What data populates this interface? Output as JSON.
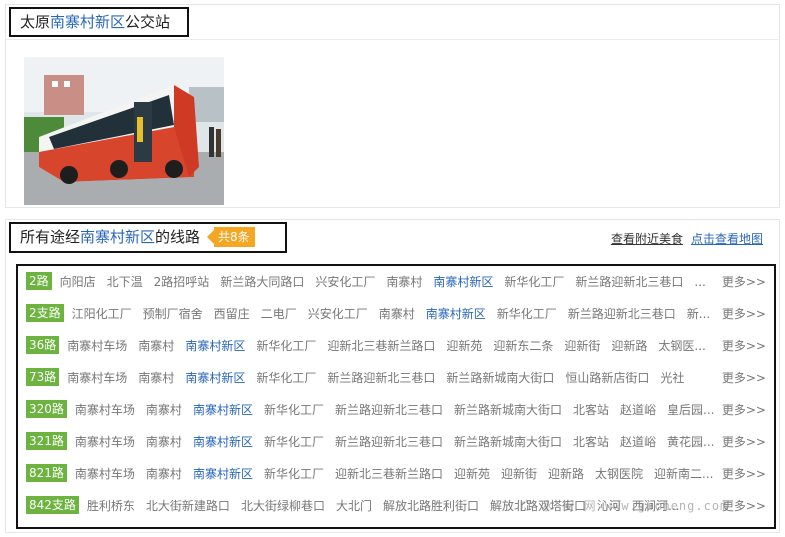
{
  "station": {
    "title_prefix": "太原",
    "title_highlight": "南寨村新区",
    "title_suffix": "公交站"
  },
  "lines_header": {
    "prefix": "所有途经",
    "highlight": "南寨村新区",
    "suffix": "的线路",
    "count": "共8条",
    "food_link": "查看附近美食",
    "map_link": "点击查看地图"
  },
  "current_stop": "南寨村新区",
  "more_label": "更多>>",
  "routes": [
    {
      "name": "2路",
      "stops": [
        "向阳店",
        "北下温",
        "2路招呼站",
        "新兰路大同路口",
        "兴安化工厂",
        "南寨村",
        "南寨村新区",
        "新华化工厂",
        "新兰路迎新北三巷口",
        "..."
      ]
    },
    {
      "name": "2支路",
      "stops": [
        "江阳化工厂",
        "预制厂宿舍",
        "西留庄",
        "二电厂",
        "兴安化工厂",
        "南寨村",
        "南寨村新区",
        "新华化工厂",
        "新兰路迎新北三巷口",
        "新..."
      ]
    },
    {
      "name": "36路",
      "stops": [
        "南寨村车场",
        "南寨村",
        "南寨村新区",
        "新华化工厂",
        "迎新北三巷新兰路口",
        "迎新苑",
        "迎新东二条",
        "迎新街",
        "迎新路",
        "太钢医..."
      ]
    },
    {
      "name": "73路",
      "stops": [
        "南寨村车场",
        "南寨村",
        "南寨村新区",
        "新华化工厂",
        "新兰路迎新北三巷口",
        "新兰路新城南大街口",
        "恒山路新店街口",
        "光社"
      ]
    },
    {
      "name": "320路",
      "stops": [
        "南寨村车场",
        "南寨村",
        "南寨村新区",
        "新华化工厂",
        "新兰路迎新北三巷口",
        "新兰路新城南大街口",
        "北客站",
        "赵道峪",
        "皇后园..."
      ]
    },
    {
      "name": "321路",
      "stops": [
        "南寨村车场",
        "南寨村",
        "南寨村新区",
        "新华化工厂",
        "新兰路迎新北三巷口",
        "新兰路新城南大街口",
        "北客站",
        "赵道峪",
        "黄花园..."
      ]
    },
    {
      "name": "821路",
      "stops": [
        "南寨村车场",
        "南寨村",
        "南寨村新区",
        "新华化工厂",
        "迎新北三巷新兰路口",
        "迎新苑",
        "迎新街",
        "迎新路",
        "太钢医院",
        "迎新南二..."
      ]
    },
    {
      "name": "842支路",
      "stops": [
        "胜利桥东",
        "北大街新建路口",
        "北大街绿柳巷口",
        "大北门",
        "解放北路胜利街口",
        "解放北路双塔街口",
        "沁河",
        "西涧河..."
      ]
    }
  ],
  "watermark": "广 水 安 网 www.gucheng.com"
}
